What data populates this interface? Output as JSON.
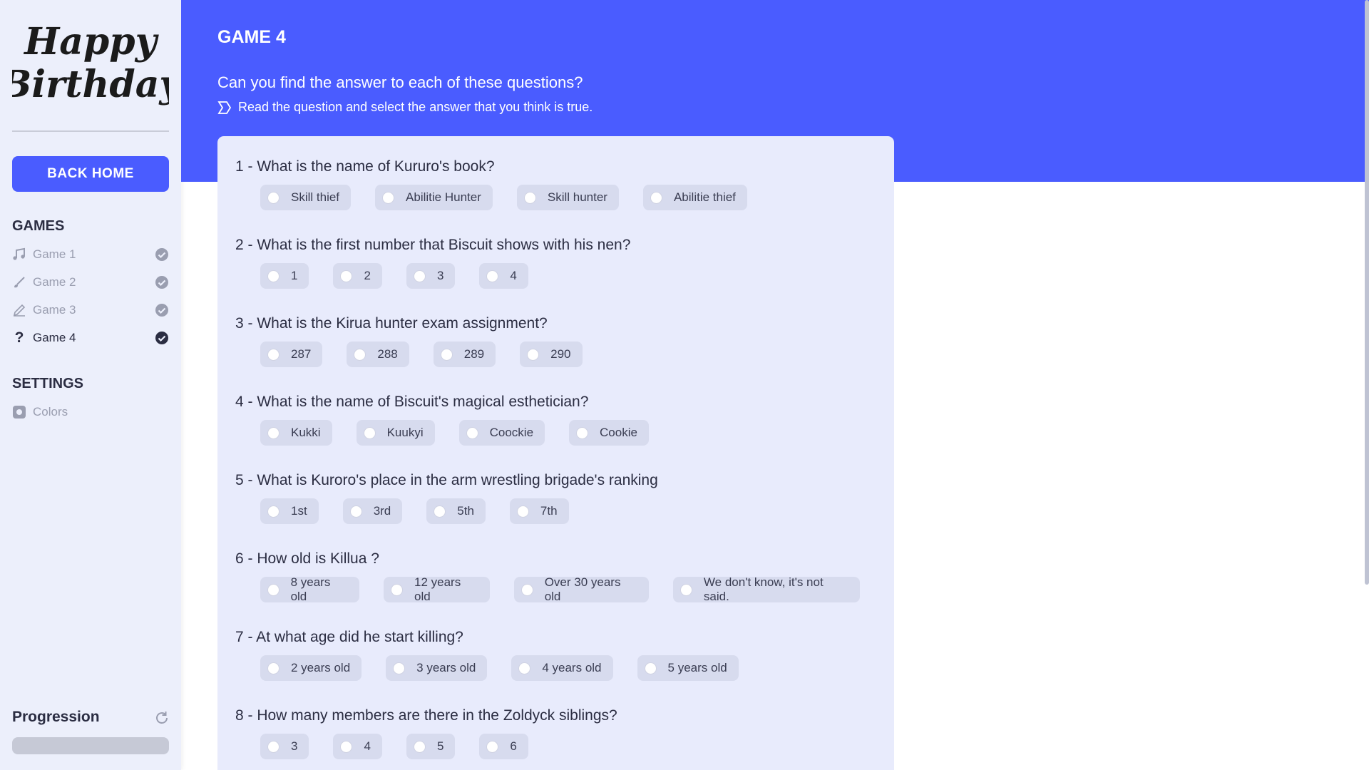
{
  "sidebar": {
    "logo_text": "Happy Birthday",
    "back_home_label": "BACK HOME",
    "games_heading": "GAMES",
    "games": [
      {
        "label": "Game 1",
        "icon": "music-note-icon",
        "completed": true,
        "active": false
      },
      {
        "label": "Game 2",
        "icon": "brush-icon",
        "completed": true,
        "active": false
      },
      {
        "label": "Game 3",
        "icon": "pencil-icon",
        "completed": true,
        "active": false
      },
      {
        "label": "Game 4",
        "icon": "question-mark-icon",
        "completed": true,
        "active": true
      }
    ],
    "settings_heading": "SETTINGS",
    "settings": [
      {
        "label": "Colors",
        "icon": "palette-icon"
      }
    ],
    "progression_label": "Progression",
    "progression_value": 0
  },
  "header": {
    "game_title": "GAME 4",
    "question_heading": "Can you find the answer to each of these questions?",
    "hint": "Read the question and select the answer that you think is true."
  },
  "quiz": {
    "questions": [
      {
        "text": "1 - What is the name of Kururo's book?",
        "options": [
          "Skill thief",
          "Abilitie Hunter",
          "Skill hunter",
          "Abilitie thief"
        ]
      },
      {
        "text": "2 - What is the first number that Biscuit shows with his nen?",
        "options": [
          "1",
          "2",
          "3",
          "4"
        ]
      },
      {
        "text": "3 - What is the Kirua hunter exam assignment?",
        "options": [
          "287",
          "288",
          "289",
          "290"
        ]
      },
      {
        "text": "4 - What is the name of Biscuit's magical esthetician?",
        "options": [
          "Kukki",
          "Kuukyi",
          "Coockie",
          "Cookie"
        ]
      },
      {
        "text": "5 - What is Kuroro's place in the arm wrestling brigade's ranking",
        "options": [
          "1st",
          "3rd",
          "5th",
          "7th"
        ]
      },
      {
        "text": "6 - How old is Killua ?",
        "options": [
          "8 years old",
          "12 years old",
          "Over 30 years old",
          "We don't know, it's not said."
        ]
      },
      {
        "text": "7 - At what age did he start killing?",
        "options": [
          "2 years old",
          "3 years old",
          "4 years old",
          "5 years old"
        ]
      },
      {
        "text": "8 - How many members are there in the Zoldyck siblings?",
        "options": [
          "3",
          "4",
          "5",
          "6"
        ]
      }
    ]
  },
  "colors": {
    "accent": "#4a5cff",
    "sidebar_bg": "#eceffb",
    "card_bg": "#e8ebfc",
    "option_bg": "#d7dbee",
    "text_dark": "#2b2d42",
    "text_muted": "#9a9eb0"
  }
}
